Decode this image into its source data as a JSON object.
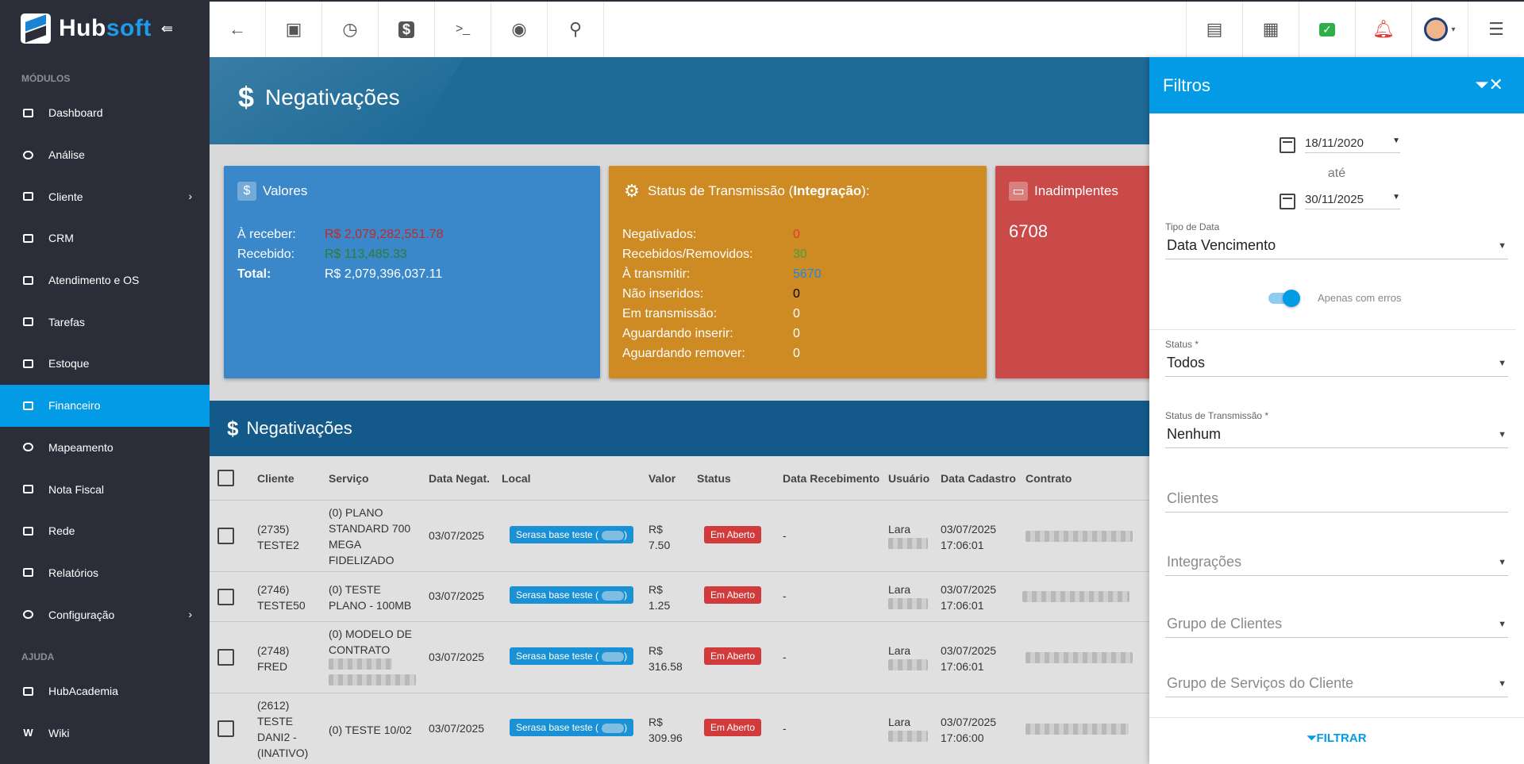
{
  "brand": {
    "name_main": "Hub",
    "name_accent": "soft"
  },
  "sidebar": {
    "section_modules": "MÓDULOS",
    "items": [
      {
        "label": "Dashboard"
      },
      {
        "label": "Análise"
      },
      {
        "label": "Cliente"
      },
      {
        "label": "CRM"
      },
      {
        "label": "Atendimento e OS"
      },
      {
        "label": "Tarefas"
      },
      {
        "label": "Estoque"
      },
      {
        "label": "Financeiro"
      },
      {
        "label": "Mapeamento"
      },
      {
        "label": "Nota Fiscal"
      },
      {
        "label": "Rede"
      },
      {
        "label": "Relatórios"
      },
      {
        "label": "Configuração"
      }
    ],
    "section_help": "AJUDA",
    "help_items": [
      {
        "label": "HubAcademia"
      },
      {
        "label": "Wiki"
      }
    ]
  },
  "page": {
    "title": "Negativações",
    "dollar": "$"
  },
  "cards": {
    "valores": {
      "title": "Valores",
      "rows": [
        {
          "k": "À receber:",
          "v": "R$ 2,079,282,551.78",
          "color": "#c62828"
        },
        {
          "k": "Recebido:",
          "v": "R$ 113,485.33",
          "color": "#2e7d32"
        },
        {
          "k": "Total:",
          "v": "R$ 2,079,396,037.11",
          "color": "#ffffff"
        }
      ]
    },
    "status": {
      "title_main": "Status de Transmissão (",
      "title_bold": "Integração",
      "title_end": "):",
      "rows": [
        {
          "k": "Negativados:",
          "v": "0",
          "color": "#e53935"
        },
        {
          "k": "Recebidos/Removidos:",
          "v": "30",
          "color": "#43a047"
        },
        {
          "k": "À transmitir:",
          "v": "5670",
          "color": "#1e88e5"
        },
        {
          "k": "Não inseridos:",
          "v": "0",
          "color": "#000000"
        },
        {
          "k": "Em transmissão:",
          "v": "0",
          "color": "#ffffff"
        },
        {
          "k": "Aguardando inserir:",
          "v": "0",
          "color": "#ffffff"
        },
        {
          "k": "Aguardando remover:",
          "v": "0",
          "color": "#ffffff"
        }
      ]
    },
    "inadimplentes": {
      "title": "Inadimplentes",
      "value": "6708"
    }
  },
  "table": {
    "title": "Negativações",
    "columns": [
      "Cliente",
      "Serviço",
      "Data Negat.",
      "Local",
      "Valor",
      "Status",
      "Data Recebimento",
      "Usuário",
      "Data Cadastro",
      "Contrato"
    ],
    "rows": [
      {
        "cliente": "(2735) TESTE2",
        "servico": "(0) PLANO STANDARD 700 MEGA FIDELIZADO",
        "data": "03/07/2025",
        "local": "Serasa base teste (",
        "valor": "R$ 7.50",
        "status": "Em Aberto",
        "receb": "-",
        "usuario": "Lara",
        "cadastro": "03/07/2025 17:06:01"
      },
      {
        "cliente": "(2746) TESTE50",
        "servico": "(0) TESTE PLANO - 100MB",
        "data": "03/07/2025",
        "local": "Serasa base teste (",
        "valor": "R$ 1.25",
        "status": "Em Aberto",
        "receb": "-",
        "usuario": "Lara",
        "cadastro": "03/07/2025 17:06:01"
      },
      {
        "cliente": "(2748) FRED",
        "servico": "(0) MODELO DE CONTRATO",
        "data": "03/07/2025",
        "local": "Serasa base teste (",
        "valor": "R$ 316.58",
        "status": "Em Aberto",
        "receb": "-",
        "usuario": "Lara",
        "cadastro": "03/07/2025 17:06:01"
      },
      {
        "cliente": "(2612) TESTE DANI2 - (INATIVO)",
        "servico": "(0) TESTE 10/02",
        "data": "03/07/2025",
        "local": "Serasa base teste (",
        "valor": "R$ 309.96",
        "status": "Em Aberto",
        "receb": "-",
        "usuario": "Lara",
        "cadastro": "03/07/2025 17:06:00"
      }
    ]
  },
  "filters": {
    "title": "Filtros",
    "date_from": "18/11/2020",
    "date_sep": "até",
    "date_to": "30/11/2025",
    "tipo_data": {
      "label": "Tipo de Data",
      "value": "Data Vencimento"
    },
    "toggle_label": "Apenas com erros",
    "status": {
      "label": "Status *",
      "value": "Todos"
    },
    "status_trans": {
      "label": "Status de Transmissão *",
      "value": "Nenhum"
    },
    "clientes": {
      "placeholder": "Clientes"
    },
    "integracoes": {
      "placeholder": "Integrações"
    },
    "grupo_clientes": {
      "placeholder": "Grupo de Clientes"
    },
    "grupo_servicos": {
      "placeholder": "Grupo de Serviços do Cliente"
    },
    "button": "FILTRAR"
  }
}
